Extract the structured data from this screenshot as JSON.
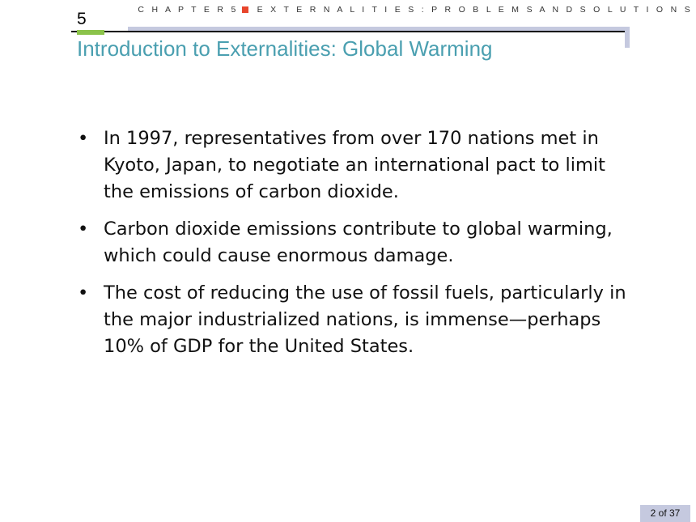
{
  "header": {
    "chapter_label": "C H A P T E R 5",
    "section_label": "E X T E R N A L I T I E S : P R O B L E M S A N D S O L U T I O N S",
    "accent_color": "#e8452c"
  },
  "slide": {
    "chapter_number": "5",
    "title": "Introduction to Externalities: Global Warming",
    "title_color": "#4a9fb0",
    "bullets": [
      "In 1997, representatives from over 170 nations met in Kyoto, Japan, to negotiate an international pact to limit the emissions of carbon dioxide.",
      "Carbon dioxide emissions contribute to global warming, which could cause enormous damage.",
      "The cost of reducing the use of fossil fuels, particularly in the major industrialized nations, is immense—perhaps 10% of GDP for the United States."
    ]
  },
  "footer": {
    "page_indicator": "2 of 37"
  }
}
